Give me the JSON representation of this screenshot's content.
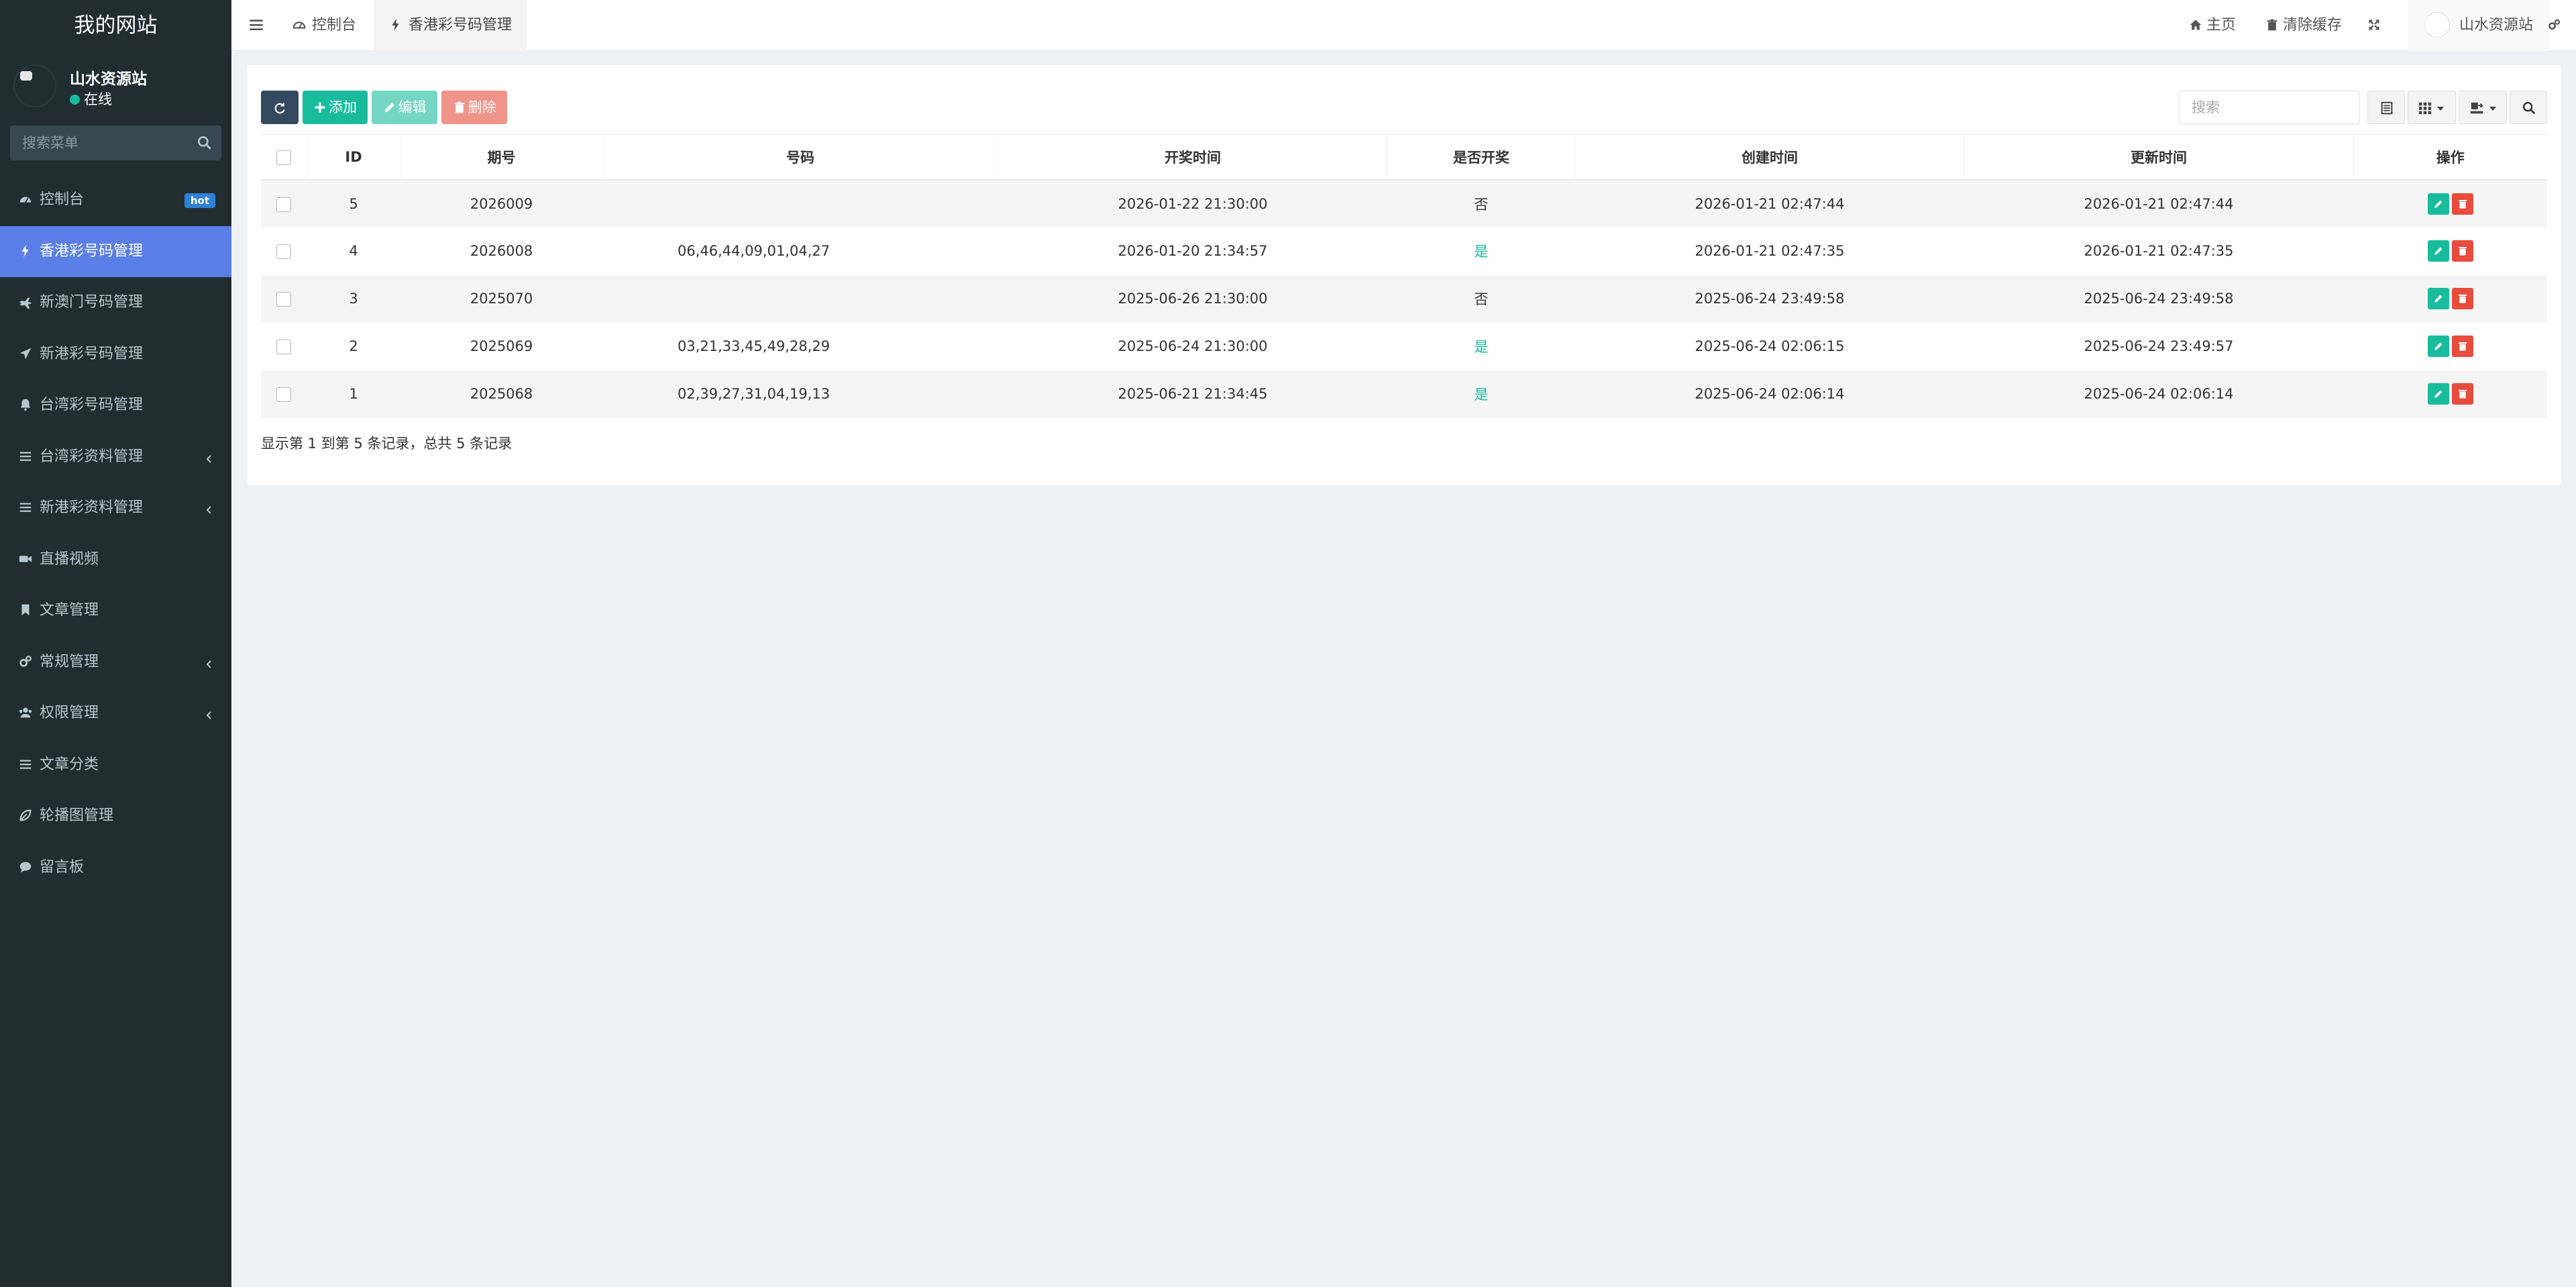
{
  "sidebar": {
    "logo": "我的网站",
    "user_name": "山水资源站",
    "user_status": "在线",
    "search_placeholder": "搜索菜单",
    "items": [
      {
        "label": "控制台",
        "icon": "dashboard-icon",
        "badge": "hot"
      },
      {
        "label": "香港彩号码管理",
        "icon": "bolt-icon",
        "active": true
      },
      {
        "label": "新澳门号码管理",
        "icon": "plane-icon"
      },
      {
        "label": "新港彩号码管理",
        "icon": "send-icon"
      },
      {
        "label": "台湾彩号码管理",
        "icon": "bell-icon"
      },
      {
        "label": "台湾彩资料管理",
        "icon": "list-icon",
        "expandable": true
      },
      {
        "label": "新港彩资料管理",
        "icon": "list-icon",
        "expandable": true
      },
      {
        "label": "直播视频",
        "icon": "video-icon"
      },
      {
        "label": "文章管理",
        "icon": "bookmark-icon"
      },
      {
        "label": "常规管理",
        "icon": "cogs-icon",
        "expandable": true
      },
      {
        "label": "权限管理",
        "icon": "group-icon",
        "expandable": true
      },
      {
        "label": "文章分类",
        "icon": "list-icon"
      },
      {
        "label": "轮播图管理",
        "icon": "leaf-icon"
      },
      {
        "label": "留言板",
        "icon": "comment-icon"
      }
    ]
  },
  "navbar": {
    "tabs": [
      {
        "label": "控制台",
        "icon": "dashboard-icon"
      },
      {
        "label": "香港彩号码管理",
        "icon": "bolt-icon",
        "active": true
      }
    ],
    "home": "主页",
    "clear_cache": "清除缓存",
    "user_name": "山水资源站"
  },
  "toolbar": {
    "add": "添加",
    "edit": "编辑",
    "delete": "删除",
    "search_placeholder": "搜索"
  },
  "table": {
    "columns": [
      "ID",
      "期号",
      "号码",
      "开奖时间",
      "是否开奖",
      "创建时间",
      "更新时间",
      "操作"
    ],
    "rows": [
      {
        "id": "5",
        "issue": "2026009",
        "numbers": "",
        "draw_time": "2026-01-22 21:30:00",
        "drawn": "否",
        "created": "2026-01-21 02:47:44",
        "updated": "2026-01-21 02:47:44"
      },
      {
        "id": "4",
        "issue": "2026008",
        "numbers": "06,46,44,09,01,04,27",
        "draw_time": "2026-01-20 21:34:57",
        "drawn": "是",
        "created": "2026-01-21 02:47:35",
        "updated": "2026-01-21 02:47:35"
      },
      {
        "id": "3",
        "issue": "2025070",
        "numbers": "",
        "draw_time": "2025-06-26 21:30:00",
        "drawn": "否",
        "created": "2025-06-24 23:49:58",
        "updated": "2025-06-24 23:49:58"
      },
      {
        "id": "2",
        "issue": "2025069",
        "numbers": "03,21,33,45,49,28,29",
        "draw_time": "2025-06-24 21:30:00",
        "drawn": "是",
        "created": "2025-06-24 02:06:15",
        "updated": "2025-06-24 23:49:57"
      },
      {
        "id": "1",
        "issue": "2025068",
        "numbers": "02,39,27,31,04,19,13",
        "draw_time": "2025-06-21 21:34:45",
        "drawn": "是",
        "created": "2025-06-24 02:06:14",
        "updated": "2025-06-24 02:06:14"
      }
    ]
  },
  "pagination_info": "显示第 1 到第 5 条记录，总共 5 条记录",
  "colors": {
    "sidebar_bg": "#222d32",
    "active_menu": "#5b7fe6",
    "success": "#18bc9c",
    "danger": "#e74c3c",
    "dark_btn": "#34495e"
  }
}
